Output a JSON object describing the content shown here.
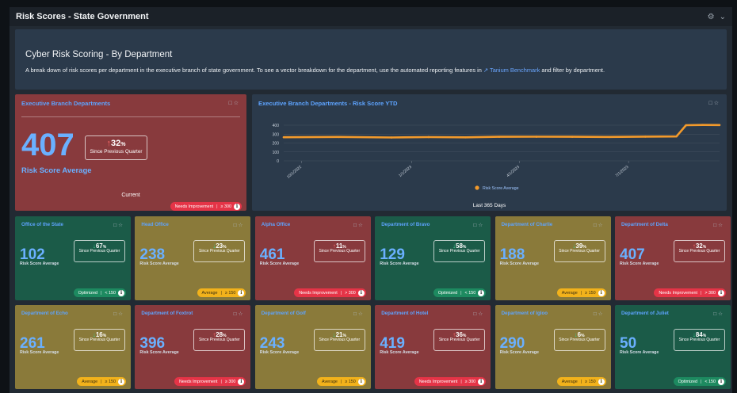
{
  "window": {
    "title": "Risk Scores - State Government"
  },
  "intro": {
    "heading": "Cyber Risk Scoring - By Department",
    "text_before": "A break down of risk scores per department in the executive branch of state government.  To see a vector breakdown for the department, use the automated reporting features in ",
    "link": "Tanium Benchmark",
    "text_after": " and filter by department."
  },
  "exec": {
    "title": "Executive Branch Departments",
    "score": "407",
    "change": "32",
    "unit": "%",
    "since": "Since Previous Quarter",
    "label": "Risk Score Average",
    "current": "Current",
    "badge_status": "Needs Improvement",
    "badge_range": "≥ 300"
  },
  "ytd": {
    "title": "Executive Branch Departments - Risk Score YTD",
    "footer": "Last 365 Days"
  },
  "chart_data": {
    "type": "line",
    "title": "Executive Branch Departments - Risk Score YTD",
    "series": [
      {
        "name": "Risk Score Average",
        "color": "#f39a2b"
      }
    ],
    "y_ticks": [
      "400",
      "300",
      "200",
      "100",
      "0"
    ],
    "ylim": [
      0,
      400
    ],
    "x_ticks": [
      "10/1/2022",
      "1/1/2023",
      "4/1/2023",
      "7/1/2023"
    ],
    "grid": true,
    "legend": "bottom-center",
    "points": [
      {
        "x": "2022-09-16",
        "y": 265
      },
      {
        "x": "2022-11-01",
        "y": 268
      },
      {
        "x": "2022-12-15",
        "y": 262
      },
      {
        "x": "2023-01-15",
        "y": 267
      },
      {
        "x": "2023-02-15",
        "y": 264
      },
      {
        "x": "2023-03-15",
        "y": 270
      },
      {
        "x": "2023-04-15",
        "y": 271
      },
      {
        "x": "2023-05-15",
        "y": 270
      },
      {
        "x": "2023-06-15",
        "y": 268
      },
      {
        "x": "2023-07-15",
        "y": 272
      },
      {
        "x": "2023-08-10",
        "y": 274
      },
      {
        "x": "2023-08-18",
        "y": 400
      },
      {
        "x": "2023-09-01",
        "y": 403
      },
      {
        "x": "2023-09-15",
        "y": 402
      }
    ]
  },
  "tiles": [
    {
      "title": "Office of the State",
      "score": "102",
      "dir": "down",
      "change": "67",
      "unit": "%",
      "since": "Since Previous Quarter",
      "label": "Risk Score Average",
      "status": "Optimized",
      "range": "< 150",
      "theme": "green"
    },
    {
      "title": "Head Office",
      "score": "238",
      "dir": "down",
      "change": "23",
      "unit": "%",
      "since": "Since Previous Quarter",
      "label": "Risk Score Average",
      "status": "Average",
      "range": "≥ 150",
      "theme": "yellow"
    },
    {
      "title": "Alpha Office",
      "score": "461",
      "dir": "up",
      "change": "11",
      "unit": "%",
      "since": "Since Previous Quarter",
      "label": "Risk Score Average",
      "status": "Needs Improvement",
      "range": "> 300",
      "theme": "red"
    },
    {
      "title": "Department of Bravo",
      "score": "129",
      "dir": "down",
      "change": "58",
      "unit": "%",
      "since": "Since Previous Quarter",
      "label": "Risk Score Average",
      "status": "Optimized",
      "range": "< 150",
      "theme": "green"
    },
    {
      "title": "Department of Charlie",
      "score": "188",
      "dir": "down",
      "change": "39",
      "unit": "%",
      "since": "Since Previous Quarter",
      "label": "Risk Score Average",
      "status": "Average",
      "range": "≥ 150",
      "theme": "yellow"
    },
    {
      "title": "Department of Delta",
      "score": "407",
      "dir": "up",
      "change": "32",
      "unit": "%",
      "since": "Since Previous Quarter",
      "label": "Risk Score Average",
      "status": "Needs Improvement",
      "range": "> 300",
      "theme": "red"
    },
    {
      "title": "Department of Echo",
      "score": "261",
      "dir": "down",
      "change": "16",
      "unit": "%",
      "since": "Since Previous Quarter",
      "label": "Risk Score Average",
      "status": "Average",
      "range": "≥ 150",
      "theme": "yellow"
    },
    {
      "title": "Department of Foxtrot",
      "score": "396",
      "dir": "up",
      "change": "28",
      "unit": "%",
      "since": "Since Previous Quarter",
      "label": "Risk Score Average",
      "status": "Needs Improvement",
      "range": "≥ 300",
      "theme": "red"
    },
    {
      "title": "Department of Golf",
      "score": "243",
      "dir": "down",
      "change": "21",
      "unit": "%",
      "since": "Since Previous Quarter",
      "label": "Risk Score Average",
      "status": "Average",
      "range": "≥ 150",
      "theme": "yellow"
    },
    {
      "title": "Department of Hotel",
      "score": "419",
      "dir": "up",
      "change": "36",
      "unit": "%",
      "since": "Since Previous Quarter",
      "label": "Risk Score Average",
      "status": "Needs Improvement",
      "range": "≥ 300",
      "theme": "red"
    },
    {
      "title": "Department of Igloo",
      "score": "290",
      "dir": "down",
      "change": "6",
      "unit": "%",
      "since": "Since Previous Quarter",
      "label": "Risk Score Average",
      "status": "Average",
      "range": "≥ 150",
      "theme": "yellow"
    },
    {
      "title": "Department of Juliet",
      "score": "50",
      "dir": "down",
      "change": "84",
      "unit": "%",
      "since": "Since Previous Quarter",
      "label": "Risk Score Average",
      "status": "Optimized",
      "range": "< 150",
      "theme": "green"
    }
  ],
  "colors": {
    "red": "#883a3d",
    "green": "#1b5b48",
    "yellow": "#8a7a3a",
    "navy": "#2b3a4b",
    "accent": "#6ab0ff",
    "line": "#f39a2b"
  },
  "icons": {
    "panel_icons": [
      "comment-icon",
      "star-icon"
    ],
    "window_icons": [
      "gear-icon",
      "chevron-down-icon"
    ]
  }
}
